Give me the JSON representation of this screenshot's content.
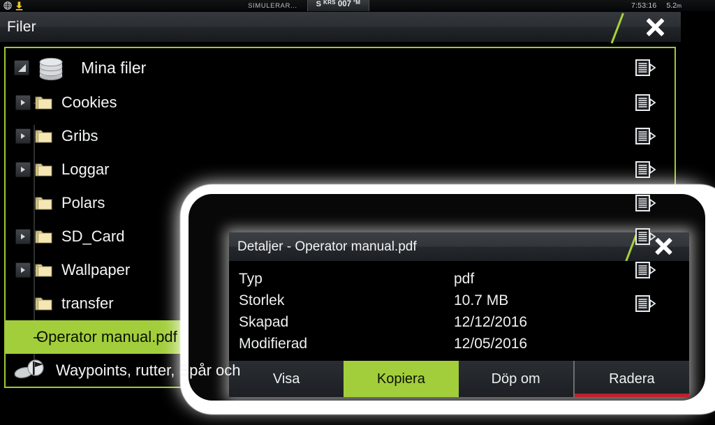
{
  "statusbar": {
    "globe_icon": "globe-icon",
    "alert_icon": "download-alert-icon",
    "simulator_label": "SIMULERAR...",
    "heading_prefix": "S",
    "heading_label": "KRS",
    "heading_value": "007",
    "heading_unit": "°M",
    "clock": "7:53:16",
    "depth_value": "5.2",
    "depth_unit": "m"
  },
  "window": {
    "title": "Filer",
    "close_icon": "close-icon"
  },
  "tree": {
    "root": {
      "label": "Mina filer",
      "icon": "disk-stack-icon",
      "expander": "collapse-icon",
      "details_icon": "document-details-icon"
    },
    "items": [
      {
        "label": "Cookies",
        "icon": "folder-icon",
        "expandable": true,
        "details_icon": "document-details-icon"
      },
      {
        "label": "Gribs",
        "icon": "folder-icon",
        "expandable": true,
        "details_icon": "document-details-icon"
      },
      {
        "label": "Loggar",
        "icon": "folder-icon",
        "expandable": true,
        "details_icon": "document-details-icon"
      },
      {
        "label": "Polars",
        "icon": "folder-icon",
        "expandable": false,
        "details_icon": "document-details-icon"
      },
      {
        "label": "SD_Card",
        "icon": "folder-icon",
        "expandable": true,
        "details_icon": "document-details-icon"
      },
      {
        "label": "Wallpaper",
        "icon": "folder-icon",
        "expandable": true,
        "details_icon": "document-details-icon"
      },
      {
        "label": "transfer",
        "icon": "folder-icon",
        "expandable": false,
        "details_icon": "document-details-icon"
      }
    ],
    "selected": {
      "label": "Operator manual.pdf",
      "selected_bg": "#a3ce3c"
    },
    "waypoints": {
      "label": "Waypoints, rutter, Spår och",
      "icon": "waypoint-flag-icon"
    }
  },
  "dialog": {
    "title": "Detaljer - Operator manual.pdf",
    "close_icon": "close-icon",
    "details": [
      {
        "key": "Typ",
        "value": "pdf"
      },
      {
        "key": "Storlek",
        "value": "10.7 MB"
      },
      {
        "key": "Skapad",
        "value": "12/12/2016"
      },
      {
        "key": "Modifierad",
        "value": "12/05/2016"
      }
    ],
    "buttons": [
      {
        "label": "Visa",
        "style": "normal"
      },
      {
        "label": "Kopiera",
        "style": "primary"
      },
      {
        "label": "Döp om",
        "style": "normal"
      },
      {
        "label": "Radera",
        "style": "danger"
      }
    ]
  },
  "colors": {
    "accent_green": "#a3ce3c",
    "panel_border": "#9ecb32",
    "danger_red": "#c0202a",
    "folder_yellow": "#f3e3a6",
    "background": "#000000"
  }
}
